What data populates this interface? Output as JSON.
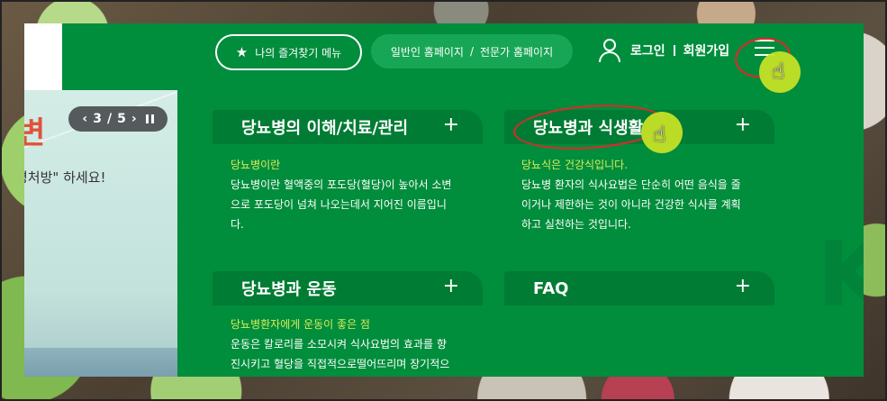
{
  "header": {
    "favorites_label": "나의 즐겨찾기 메뉴",
    "favorites_icon": "star-icon",
    "site_general": "일반인 홈페이지",
    "site_divider": "/",
    "site_expert": "전문가 홈페이지",
    "user_icon": "user-icon",
    "login": "로그인",
    "signup": "회원가입",
    "menu_icon": "hamburger-menu-icon"
  },
  "slider": {
    "heading_fragment": "변",
    "sub_text": "명처방\" 하세요!",
    "pager": {
      "prev": "‹",
      "current": "3",
      "separator": "/",
      "total": "5",
      "next": "›",
      "pause_icon": "pause-icon"
    }
  },
  "menu": {
    "sections": [
      {
        "title": "당뇨병의 이해/치료/관리",
        "expand": "+",
        "highlight": "당뇨병이란",
        "lines": [
          "당뇨병이란 혈액중의 포도당(혈당)이 높아서 소변",
          "으로 포도당이 넘쳐 나오는데서 지어진 이름입니",
          "다."
        ]
      },
      {
        "title": "당뇨병과 식생활",
        "expand": "+",
        "highlight": "당뇨식은 건강식입니다.",
        "lines": [
          "당뇨병 환자의 식사요법은 단순히 어떤 음식을 줄",
          "이거나 제한하는 것이 아니라 건강한 식사를 계획",
          "하고 실천하는 것입니다."
        ]
      },
      {
        "title": "당뇨병과 운동",
        "expand": "+",
        "highlight": "당뇨병환자에게 운동이 좋은 점",
        "lines": [
          "운동은 칼로리를 소모시켜 식사요법의 효과를 향",
          "진시키고 혈당을 직접적으로떨어뜨리며 장기적으"
        ]
      },
      {
        "title": "FAQ",
        "expand": "+",
        "highlight": "",
        "lines": []
      }
    ]
  },
  "watermark": "K",
  "colors": {
    "panel": "#008d3c",
    "category_bar": "#017c34",
    "highlight_text": "#d8ee59",
    "annotation_ring": "#e4262a",
    "cursor_marker": "#c4e226"
  }
}
